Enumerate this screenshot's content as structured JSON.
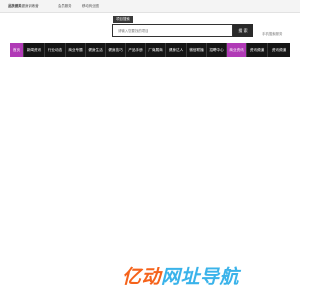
{
  "topbar": {
    "brand": "品族健美",
    "brand_suffix": "健身训练营",
    "links": [
      "会员服务",
      "移动商业圈"
    ]
  },
  "search": {
    "tab_label": "项目搜索",
    "placeholder": "请输入您要找的项目",
    "button_label": "搜 索",
    "side_link": "手机搜索服务"
  },
  "nav": {
    "items": [
      "首页",
      "新闻资讯",
      "行业动态",
      "商业专题",
      "健身生活",
      "健身技巧",
      "产品手册",
      "厂商展商",
      "健身达人",
      "微信联播",
      "招聘中心",
      "商业资讯",
      "资讯频道",
      "资讯频道"
    ]
  },
  "logo": {
    "part1": "亿动",
    "part2": "网址导航",
    "color1": "#f5631b",
    "color2": "#3ab3ea"
  }
}
